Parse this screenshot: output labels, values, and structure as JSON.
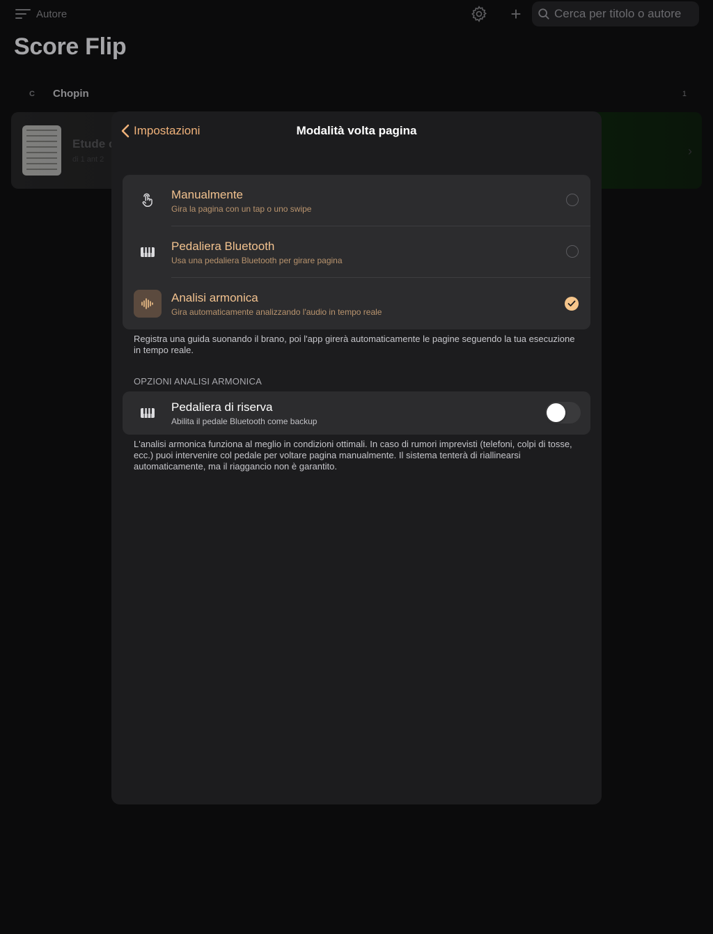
{
  "background": {
    "sort_label": "Autore",
    "search_placeholder": "Cerca per titolo o autore",
    "app_title": "Score Flip",
    "section": {
      "letter": "C",
      "name": "Chopin",
      "count": "1"
    },
    "piece": {
      "title": "Etude c",
      "subtitle": "di 1 ant 2"
    }
  },
  "modal": {
    "back_label": "Impostazioni",
    "title": "Modalità volta pagina",
    "modes": [
      {
        "title": "Manualmente",
        "subtitle": "Gira la pagina con un tap o uno swipe",
        "icon": "tap-gesture-icon",
        "selected": false
      },
      {
        "title": "Pedaliera Bluetooth",
        "subtitle": "Usa una pedaliera Bluetooth per girare pagina",
        "icon": "piano-keys-icon",
        "selected": false
      },
      {
        "title": "Analisi armonica",
        "subtitle": "Gira automaticamente analizzando l'audio in tempo reale",
        "icon": "waveform-icon",
        "selected": true
      }
    ],
    "modes_footnote": "Registra una guida suonando il brano, poi l'app girerà automaticamente le pagine seguendo la tua esecuzione in tempo reale.",
    "options_header": "OPZIONI ANALISI ARMONICA",
    "backup_pedal": {
      "title": "Pedaliera di riserva",
      "subtitle": "Abilita il pedale Bluetooth come backup",
      "enabled": false
    },
    "options_footnote": "L'analisi armonica funziona al meglio in condizioni ottimali. In caso di rumori imprevisti (telefoni, colpi di tosse, ecc.) puoi intervenire col pedale per voltare pagina manualmente. Il sistema tenterà di riallinearsi automaticamente, ma il riaggancio non è garantito."
  },
  "colors": {
    "accent": "#f5c58b",
    "accent_text": "#f2c28f",
    "modal_bg": "#1c1c1e",
    "group_bg": "#2c2c2e"
  }
}
